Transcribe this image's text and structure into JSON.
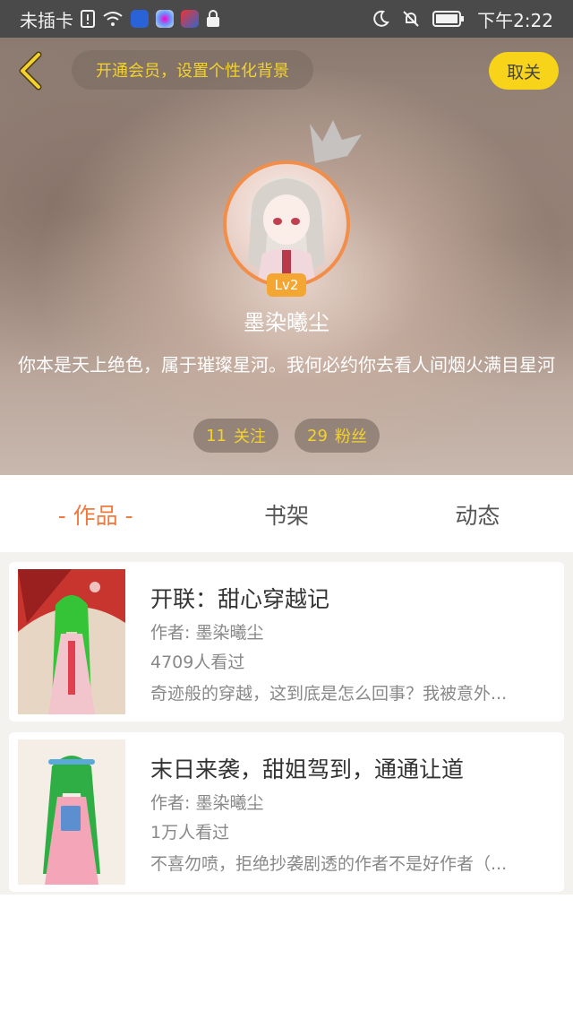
{
  "status_bar": {
    "carrier": "未插卡",
    "time": "下午2:22",
    "icons": [
      "sim-alert-icon",
      "wifi-icon",
      "baidu-app-icon",
      "color-app-icon",
      "game-app-icon",
      "lock-icon",
      "moon-icon",
      "bell-off-icon",
      "battery-icon"
    ]
  },
  "header": {
    "vip_prompt": "开通会员，设置个性化背景",
    "unfollow_label": "取关",
    "level": "Lv2",
    "username": "墨染曦尘",
    "bio": "你本是天上绝色，属于璀璨星河。我何必约你去看人间烟火满目星河",
    "following_count": "11",
    "following_label": "关注",
    "fans_count": "29",
    "fans_label": "粉丝"
  },
  "tabs": [
    {
      "label": "- 作品 -",
      "active": true
    },
    {
      "label": "书架",
      "active": false
    },
    {
      "label": "动态",
      "active": false
    }
  ],
  "works": [
    {
      "title": "开联：甜心穿越记",
      "author": "作者: 墨染曦尘",
      "reads": "4709人看过",
      "description": "奇迹般的穿越，这到底是怎么回事？我被意外..."
    },
    {
      "title": "末日来袭，甜姐驾到，通通让道",
      "author": "作者: 墨染曦尘",
      "reads": "1万人看过",
      "description": "不喜勿喷，拒绝抄袭剧透的作者不是好作者（..."
    }
  ],
  "colors": {
    "accent_orange": "#ef7a3e",
    "highlight_yellow": "#f3d22e",
    "button_yellow": "#f7d419",
    "status_bar": "#4a4a4a"
  }
}
